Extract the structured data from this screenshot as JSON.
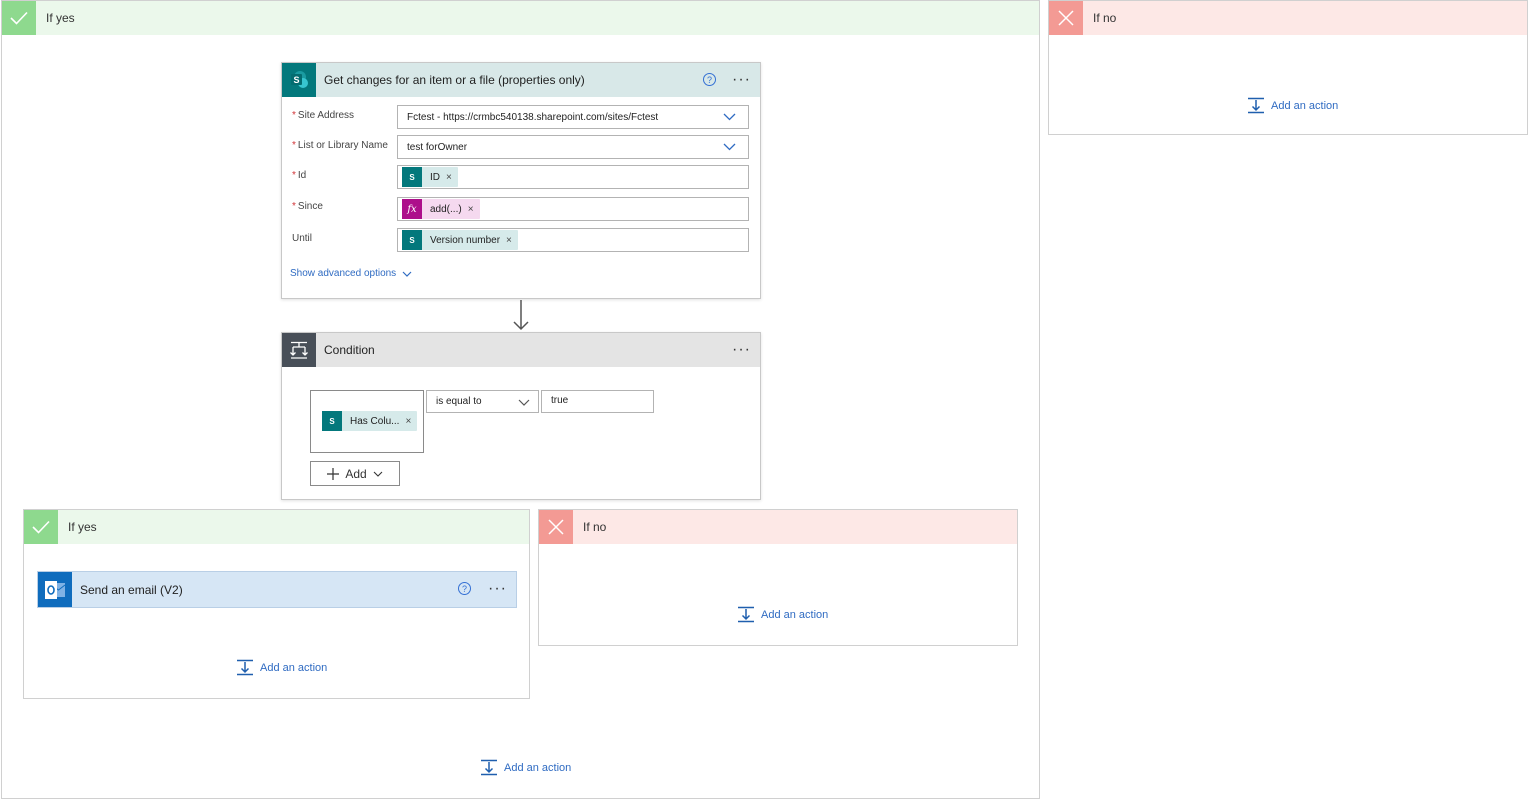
{
  "outer_yes": {
    "title": "If yes",
    "add_action": "Add an action"
  },
  "outer_no": {
    "title": "If no",
    "add_action": "Add an action"
  },
  "get_changes": {
    "title": "Get changes for an item or a file (properties only)",
    "help": "?",
    "more": "···",
    "fields": {
      "site_address": {
        "label": "Site Address",
        "value": "Fctest - https://crmbc540138.sharepoint.com/sites/Fctest"
      },
      "list_name": {
        "label": "List or Library Name",
        "value": "test forOwner"
      },
      "id": {
        "label": "Id",
        "token": "ID"
      },
      "since": {
        "label": "Since",
        "token": "add(...)"
      },
      "until": {
        "label": "Until",
        "token": "Version number"
      }
    },
    "advanced": "Show advanced options"
  },
  "condition": {
    "title": "Condition",
    "more": "···",
    "left_token": "Has Colu...",
    "operator": "is equal to",
    "right_value": "true",
    "add_label": "Add"
  },
  "inner_yes": {
    "title": "If yes",
    "email_action": {
      "title": "Send an email (V2)",
      "help": "?",
      "more": "···"
    },
    "add_action": "Add an action"
  },
  "inner_no": {
    "title": "If no",
    "add_action": "Add an action"
  },
  "token_remove": "×",
  "colors": {
    "sharepoint": "#03787c",
    "expression": "#ad0f8b",
    "link": "#2f6bc2",
    "yes": "#8ed98e",
    "no": "#f39a94",
    "outlook": "#0f6cbd"
  }
}
